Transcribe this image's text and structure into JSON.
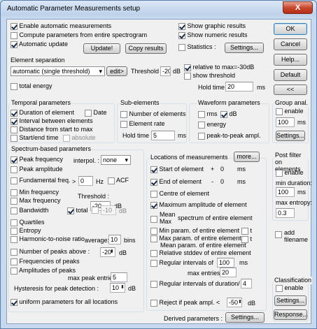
{
  "window": {
    "title": "Automatic Parameter Measurements setup",
    "close": "X"
  },
  "top": {
    "enable_auto": "Enable automatic measurements",
    "entire_spectrogram": "Compute parameters from entire spectrogram",
    "auto_update": "Automatic update",
    "update_btn": "Update!",
    "copy_btn": "Copy results",
    "show_graphic": "Show graphic results",
    "show_numeric": "Show numeric results",
    "statistics": "Statistics :",
    "settings_btn": "Settings...",
    "ok": "OK",
    "cancel": "Cancel",
    "help": "Help...",
    "default": "Default",
    "collapse": "<<"
  },
  "separation": {
    "title": "Element separation",
    "method": "automatic (single threshold)",
    "edit_btn": "edit>",
    "threshold_label": "Threshold :",
    "threshold_value": "-20",
    "threshold_unit": "dB",
    "relative": "relative to max=-30dB",
    "show_threshold": "show threshold",
    "total_energy": "total energy",
    "hold_label": "Hold time :",
    "hold_value": "20",
    "hold_unit": "ms"
  },
  "temporal": {
    "title": "Temporal parameters",
    "duration": "Duration of element",
    "date": "Date",
    "interval": "Interval between elements",
    "distance": "Distance from start to max",
    "start_end": "Start/end time",
    "absolute": "absolute"
  },
  "subelements": {
    "title": "Sub-elements",
    "number": "Number of elements",
    "rate": "Element rate",
    "hold_label": "Hold time :",
    "hold_value": "5",
    "hold_unit": "ms"
  },
  "waveform": {
    "title": "Waveform parameters",
    "rms": "rms",
    "db": "dB",
    "energy": "energy",
    "peak_to_peak": "peak-to-peak ampl."
  },
  "group": {
    "title": "Group anal.",
    "enable": "enable",
    "value": "100",
    "unit": "ms",
    "settings_btn": "Settings..."
  },
  "spectrum": {
    "title": "Spectrum-based parameters",
    "peak_freq": "Peak frequency",
    "interpol_label": "interpol. :",
    "interpol_value": "none",
    "peak_amp": "Peak amplitude",
    "fundamental": "Fundamental freq.",
    "gt": ">",
    "fund_value": "0",
    "fund_unit": "Hz",
    "acf": "ACF",
    "min_freq": "Min frequency",
    "max_freq": "Max frequency",
    "threshold_label": "Threshold :",
    "threshold_value": "-20",
    "threshold_unit": "dB",
    "bandwidth": "Bandwidth",
    "total": "total",
    "bw_value": "-10",
    "bw_unit": "dB",
    "quartiles": "Quartiles",
    "entropy": "Entropy",
    "hnr": "Harmonic-to-noise ratio",
    "average_label": "average:",
    "average_value": "10",
    "average_unit": "bins",
    "num_peaks": "Number of peaks above :",
    "num_peaks_value": "-20",
    "num_peaks_unit": "dB",
    "freq_peaks": "Frequencies of peaks",
    "amp_peaks": "Amplitudes of peaks",
    "max_entries_label": "max peak entries :",
    "max_entries_value": "5",
    "hysteresis_label": "Hysteresis for peak detection :",
    "hysteresis_value": "10",
    "hysteresis_unit": "dB",
    "uniform": "uniform parameters for all locations"
  },
  "locations": {
    "title": "Locations of measurements",
    "more_btn": "more...",
    "start": "Start of element",
    "start_sign": "+",
    "start_value": "0",
    "start_unit": "ms",
    "end": "End of element",
    "end_sign": "-",
    "end_value": "0",
    "end_unit": "ms",
    "centre": "Centre of element",
    "max_amp": "Maximum amplitude of element",
    "mean_label": "Mean",
    "max_label": "Max",
    "spectrum_entire": "spectrum of entire element",
    "min_param": "Min param. of entire element",
    "t1": "t",
    "max_param": "Max param. of entire element",
    "t2": "t",
    "mean_param": "Mean param. of entire element",
    "rel_stddev": "Relative stddev of entire element",
    "regular": "Regular intervals of",
    "regular_value": "100",
    "regular_unit": "ms",
    "max_entries_label": "max entries :",
    "max_entries_value": "20",
    "regular_duration": "Regular intervals of duration/",
    "regular_duration_value": "4",
    "reject": "Reject if peak ampl. <",
    "reject_value": "-50",
    "reject_unit": "dB",
    "derived_label": "Derived parameters :",
    "derived_btn": "Settings..."
  },
  "postfilter": {
    "title": "Post filter on elements",
    "enable": "enable",
    "min_duration_label": "min duration:",
    "min_duration_value": "100",
    "min_duration_unit": "ms",
    "max_entropy_label": "max entropy:",
    "max_entropy_value": "0.3",
    "add_filename": "add filename"
  },
  "classification": {
    "title": "Classification",
    "enable": "enable",
    "settings_btn": "Settings...",
    "response_btn": "Response..."
  }
}
